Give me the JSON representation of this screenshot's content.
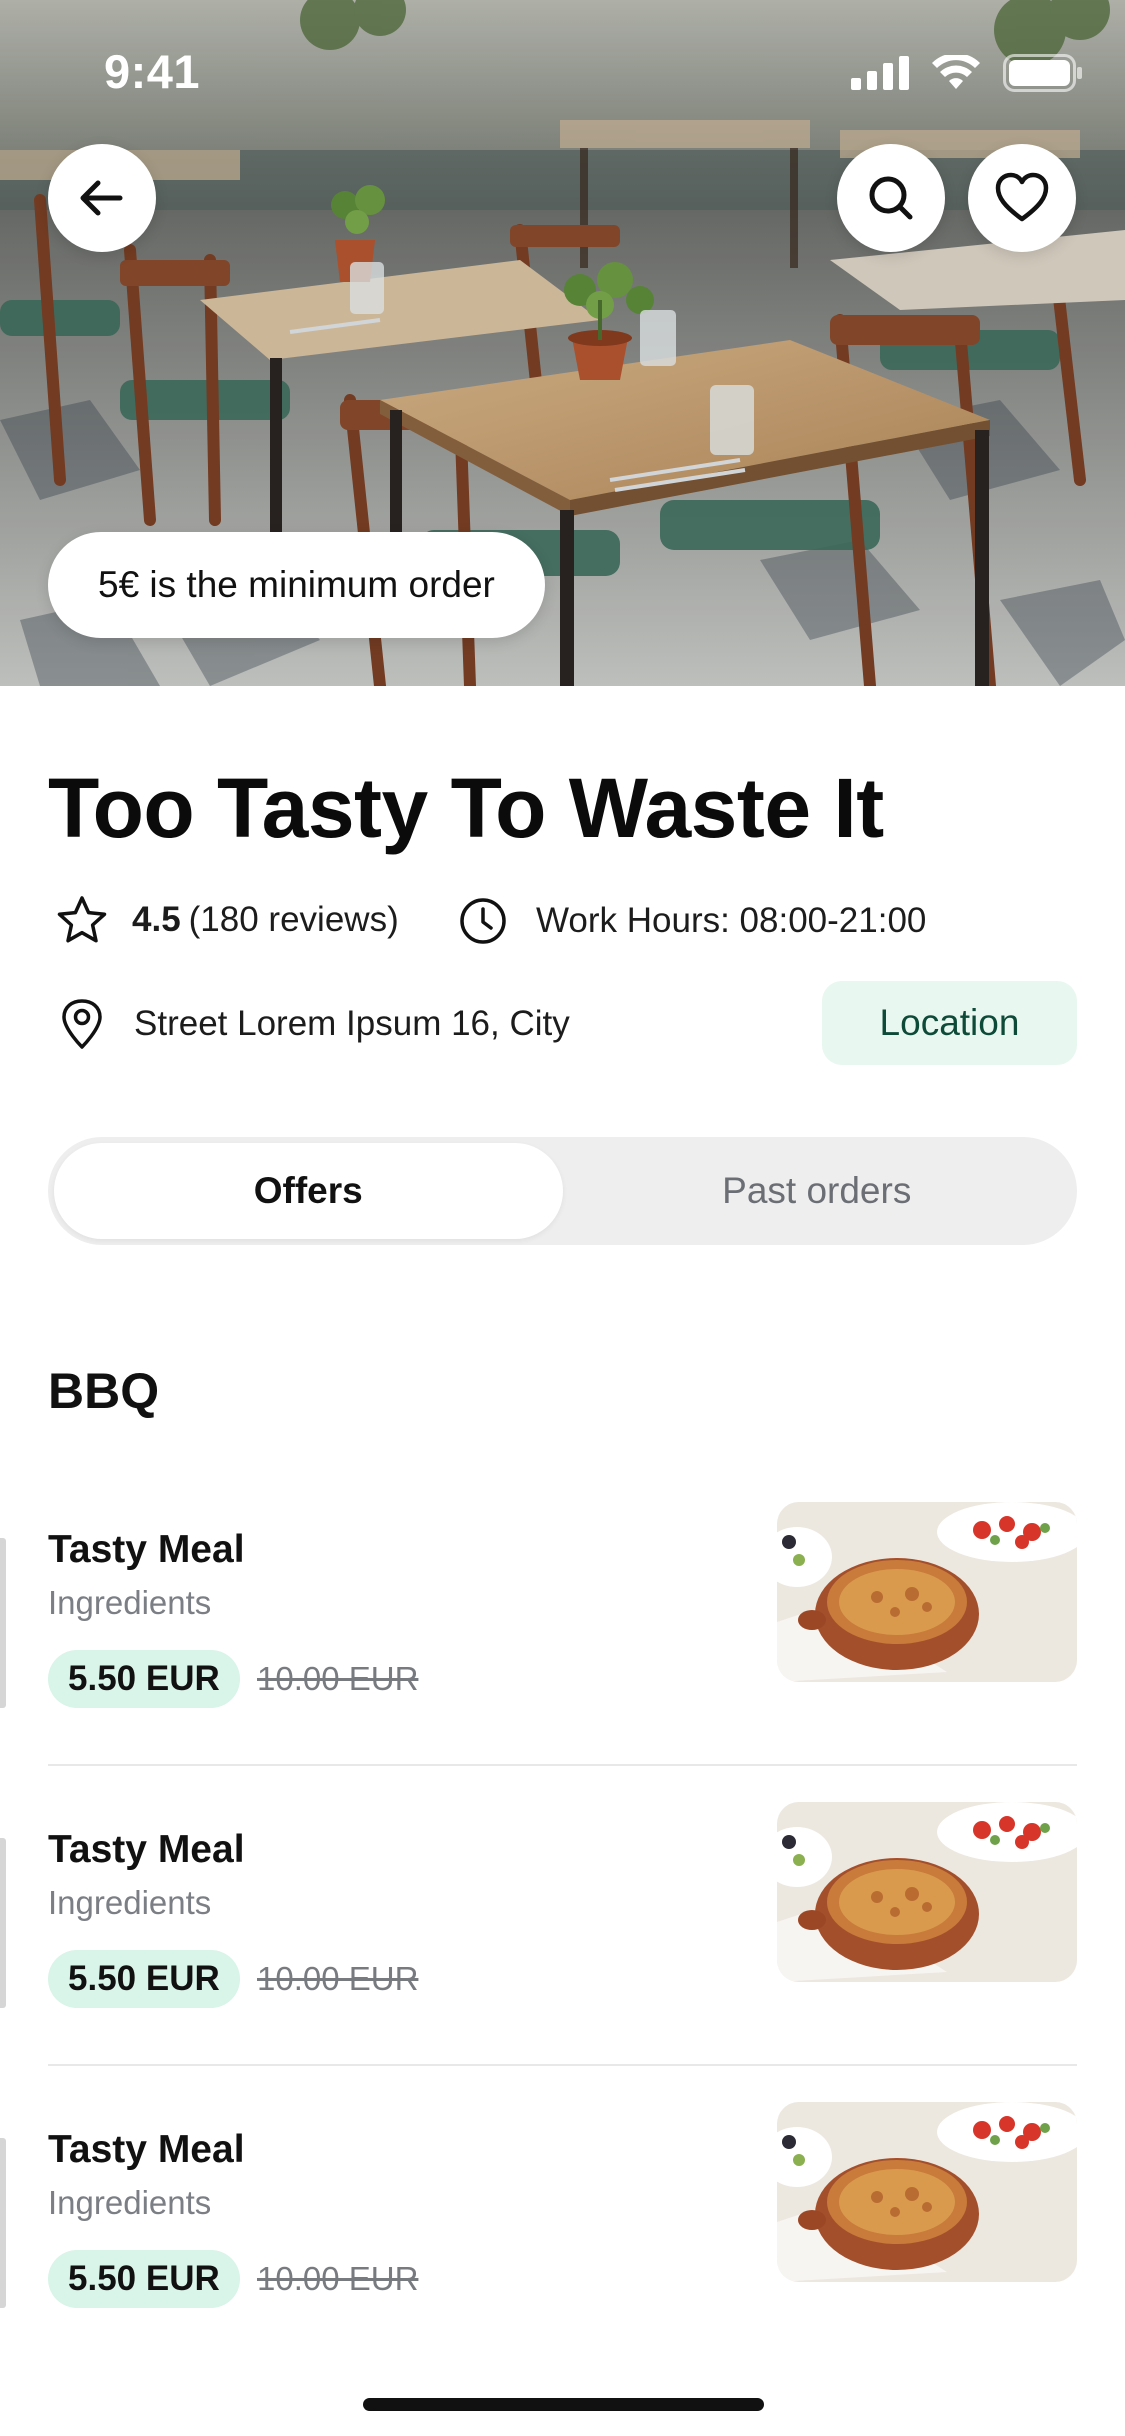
{
  "status_bar": {
    "time": "9:41"
  },
  "hero": {
    "min_order": "5€ is the minimum order"
  },
  "restaurant": {
    "name": "Too Tasty To Waste It",
    "rating": "4.5",
    "reviews": "(180 reviews)",
    "hours": "Work Hours: 08:00-21:00",
    "address": "Street Lorem Ipsum 16, City",
    "location_label": "Location"
  },
  "tabs": [
    {
      "label": "Offers",
      "active": true
    },
    {
      "label": "Past orders",
      "active": false
    }
  ],
  "section": {
    "title": "BBQ"
  },
  "meals": [
    {
      "name": "Tasty Meal",
      "ingredients": "Ingredients",
      "price": "5.50 EUR",
      "old_price": "10.00 EUR"
    },
    {
      "name": "Tasty Meal",
      "ingredients": "Ingredients",
      "price": "5.50 EUR",
      "old_price": "10.00 EUR"
    },
    {
      "name": "Tasty Meal",
      "ingredients": "Ingredients",
      "price": "5.50 EUR",
      "old_price": "10.00 EUR"
    }
  ],
  "icons": {
    "back": "arrow-left-icon",
    "search": "search-icon",
    "favorite": "heart-icon",
    "rating": "star-icon",
    "hours": "clock-icon",
    "address": "map-pin-icon"
  },
  "colors": {
    "accent_green_bg": "#d9f4e8",
    "location_bg": "#e8f7f0",
    "location_text": "#0d4a37"
  }
}
